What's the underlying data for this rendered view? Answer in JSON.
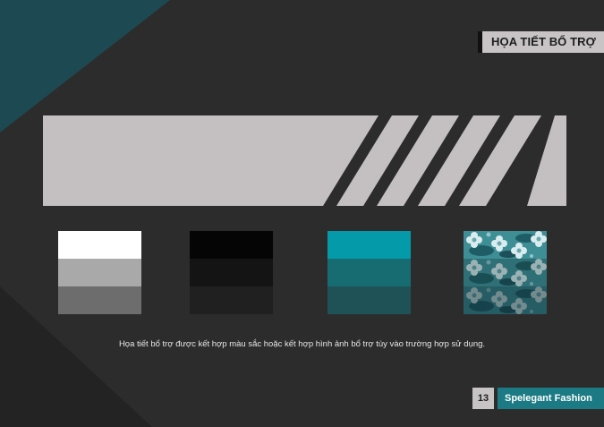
{
  "header": {
    "section_title": "HỌA TIẾT BỔ TRỢ"
  },
  "colors": {
    "background": "#2c2c2d",
    "teal_corner": "#1d4a52",
    "banner_gray": "#c4c0c1",
    "teal": "#059aaa"
  },
  "swatches": [
    {
      "name": "white-gray",
      "bands": [
        "#ffffff",
        "#a9a9a9",
        "#6d6d6d"
      ]
    },
    {
      "name": "black",
      "bands": [
        "#050505",
        "#141414",
        "#202020"
      ]
    },
    {
      "name": "teal",
      "bands": [
        "#059aaa",
        "#176c72",
        "#1e5256"
      ]
    },
    {
      "name": "floral",
      "bands": [
        "#3e8e96",
        "#2f6d74",
        "#23545a"
      ]
    }
  ],
  "caption": "Họa tiết bổ trợ được kết hợp màu sắc hoặc kết hợp hình ảnh bổ trợ tùy vào trường hợp sử dụng.",
  "footer": {
    "page_number": "13",
    "brand": "Spelegant Fashion"
  }
}
